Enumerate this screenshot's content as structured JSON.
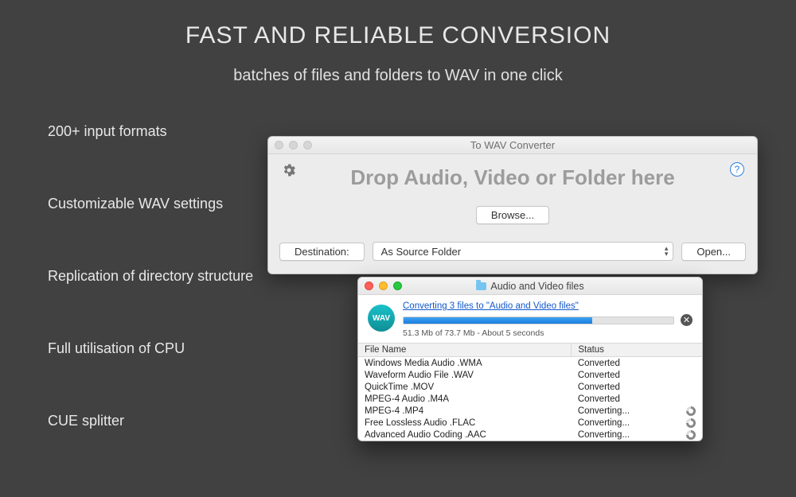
{
  "hero": {
    "title": "FAST AND RELIABLE CONVERSION",
    "subtitle": "batches of files and folders to WAV in one click"
  },
  "features": [
    "200+ input formats",
    "Customizable WAV settings",
    "Replication of directory structure",
    "Full utilisation of CPU",
    "CUE splitter"
  ],
  "drop_window": {
    "title": "To WAV Converter",
    "drop_text": "Drop Audio, Video or Folder here",
    "browse": "Browse...",
    "destination_label": "Destination:",
    "destination_value": "As Source Folder",
    "open": "Open...",
    "help": "?"
  },
  "progress_window": {
    "title": "Audio and Video files",
    "badge": "WAV",
    "link": "Converting 3 files to \"Audio and Video files\"",
    "percent": 70,
    "status": "51.3 Mb of 73.7 Mb - About 5 seconds",
    "columns": {
      "file": "File Name",
      "status": "Status"
    },
    "rows": [
      {
        "file": "Windows Media Audio .WMA",
        "status": "Converted",
        "spin": false
      },
      {
        "file": "Waveform Audio File .WAV",
        "status": "Converted",
        "spin": false
      },
      {
        "file": "QuickTime .MOV",
        "status": "Converted",
        "spin": false
      },
      {
        "file": "MPEG-4 Audio .M4A",
        "status": "Converted",
        "spin": false
      },
      {
        "file": "MPEG-4 .MP4",
        "status": "Converting...",
        "spin": true
      },
      {
        "file": "Free Lossless Audio .FLAC",
        "status": "Converting...",
        "spin": true
      },
      {
        "file": "Advanced Audio Coding .AAC",
        "status": "Converting...",
        "spin": true
      }
    ]
  }
}
